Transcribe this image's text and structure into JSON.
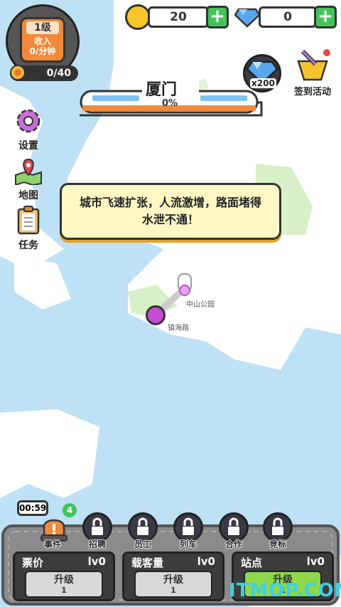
{
  "resources": {
    "coins": "20",
    "gems": "0"
  },
  "level": {
    "label": "1级",
    "income_label": "收入",
    "income_rate": "0/分钟",
    "progress": "0/40"
  },
  "side_menu": {
    "settings": "设置",
    "map": "地图",
    "tasks": "任务"
  },
  "train": {
    "city": "厦门",
    "progress": "0%"
  },
  "gem_reward": "x200",
  "checkin": "签到活动",
  "dialog": "城市飞速扩张，人流激增，路面堵得水泄不通！",
  "stations": {
    "a": "中山公园",
    "b": "镇海路"
  },
  "event": {
    "timer": "00:59",
    "badge": "4",
    "label": "事件"
  },
  "round_buttons": [
    "招聘",
    "员工",
    "列车",
    "合作",
    "竞标"
  ],
  "panels": [
    {
      "title": "票价",
      "level": "lv0",
      "button": "升级",
      "cost": "1"
    },
    {
      "title": "载客量",
      "level": "lv0",
      "button": "升级",
      "cost": "1"
    },
    {
      "title": "站点",
      "level": "lv0",
      "button": "升级",
      "cost": "1"
    }
  ],
  "watermark": "ITMOP.COM",
  "colors": {
    "sea": "#bfe1f6",
    "land": "#ffffff",
    "park": "#d8f0c8",
    "station": "#c44dd6",
    "accent_green": "#43c45a",
    "orange": "#f08a3a"
  }
}
